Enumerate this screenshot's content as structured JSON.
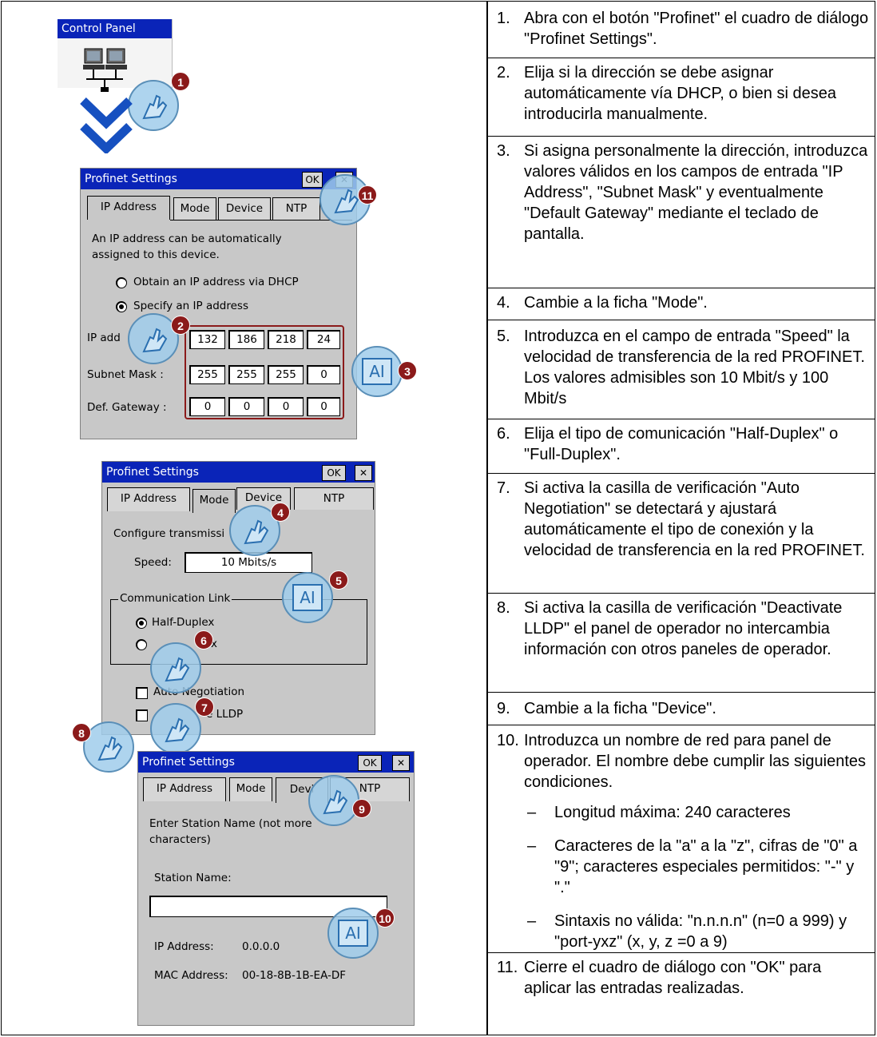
{
  "control_panel": {
    "title": "Control Panel"
  },
  "dialog1": {
    "title": "Profinet Settings",
    "ok": "OK",
    "close": "✕",
    "tabs": [
      "IP Address",
      "Mode",
      "Device",
      "NTP"
    ],
    "description_line1": "An IP address can be automatically",
    "description_line2": "assigned to this device.",
    "radio_dhcp": "Obtain an IP address via DHCP",
    "radio_specify": "Specify an IP address",
    "ip_label": "IP add",
    "subnet_label": "Subnet Mask :",
    "gateway_label": "Def. Gateway :",
    "ip": [
      "132",
      "186",
      "218",
      "24"
    ],
    "subnet": [
      "255",
      "255",
      "255",
      "0"
    ],
    "gateway": [
      "0",
      "0",
      "0",
      "0"
    ]
  },
  "dialog2": {
    "title": "Profinet Settings",
    "ok": "OK",
    "close": "✕",
    "tabs": [
      "IP Address",
      "Mode",
      "Device",
      "NTP"
    ],
    "description": "Configure transmissi",
    "speed_label": "Speed:",
    "speed_value": "10 Mbits/s",
    "group_label": "Communication Link",
    "radio_half": "Half-Duplex",
    "radio_full": "x",
    "check_auto": "Auto Negotiation",
    "check_lldp": "e LLDP"
  },
  "dialog3": {
    "title": "Profinet Settings",
    "ok": "OK",
    "close": "✕",
    "tabs": [
      "IP Address",
      "Mode",
      "Devi",
      "NTP"
    ],
    "description_line1": "Enter Station Name (not more",
    "description_line2": "characters)",
    "station_label": "Station Name:",
    "station_value": "",
    "ip_label": "IP Address:",
    "ip_value": "0.0.0.0",
    "mac_label": "MAC Address:",
    "mac_value": "00-18-8B-1B-EA-DF"
  },
  "badges": {
    "b1": "1",
    "b2": "2",
    "b3": "3",
    "b4": "4",
    "b5": "5",
    "b6": "6",
    "b7": "7",
    "b8": "8",
    "b9": "9",
    "b10": "10",
    "b11": "11"
  },
  "keyboard_icon_label": "AI",
  "steps": [
    {
      "num": "1.",
      "text": "Abra con el botón \"Profinet\" el cuadro de diálogo \"Profinet Settings\"."
    },
    {
      "num": "2.",
      "text": "Elija si la dirección se debe asignar automáticamente vía DHCP, o bien si desea introducirla manualmente."
    },
    {
      "num": "3.",
      "text": "Si asigna personalmente la dirección, introduzca valores válidos en los campos de entrada \"IP Address\", \"Subnet Mask\" y eventualmente \"Default Gateway\" mediante el teclado de pantalla."
    },
    {
      "num": "4.",
      "text": "Cambie a la ficha \"Mode\"."
    },
    {
      "num": "5.",
      "text": "Introduzca en el campo de entrada \"Speed\" la velocidad de transferencia de la red PROFINET. Los valores admisibles son 10 Mbit/s y 100 Mbit/s"
    },
    {
      "num": "6.",
      "text": "Elija el tipo de comunicación \"Half-Duplex\" o \"Full-Duplex\"."
    },
    {
      "num": "7.",
      "text": "Si activa la casilla de verificación \"Auto Negotiation\" se detectará y ajustará automáticamente el tipo de conexión y la velocidad de transferencia en la red PROFINET."
    },
    {
      "num": "8.",
      "text": "Si activa la casilla de verificación \"Deactivate LLDP\" el panel de operador no intercambia información con otros paneles de operador."
    },
    {
      "num": "9.",
      "text": "Cambie a la ficha \"Device\"."
    },
    {
      "num": "10.",
      "text": "Introduzca un nombre de red para panel de operador. El nombre debe cumplir las siguientes condiciones."
    },
    {
      "num": "11.",
      "text": "Cierre el cuadro de diálogo con \"OK\" para aplicar las entradas realizadas."
    }
  ],
  "conditions": [
    {
      "dash": "–",
      "text": "Longitud máxima: 240 caracteres"
    },
    {
      "dash": "–",
      "text": "Caracteres de la \"a\" a la \"z\", cifras de \"0\" a \"9\"; caracteres especiales permitidos: \"-\" y \".\""
    },
    {
      "dash": "–",
      "text": "Sintaxis no válida: \"n.n.n.n\" (n=0 a 999) y \"port-yxz\" (x, y, z =0 a 9)"
    }
  ],
  "colors": {
    "titlebar": "#0a24b8",
    "dialog_bg": "#c8c8c8",
    "badge": "#8b1a1a",
    "highlight_box": "#8b1a1a",
    "arrow": "#1650c0",
    "bubble": "#a0cdeb"
  }
}
